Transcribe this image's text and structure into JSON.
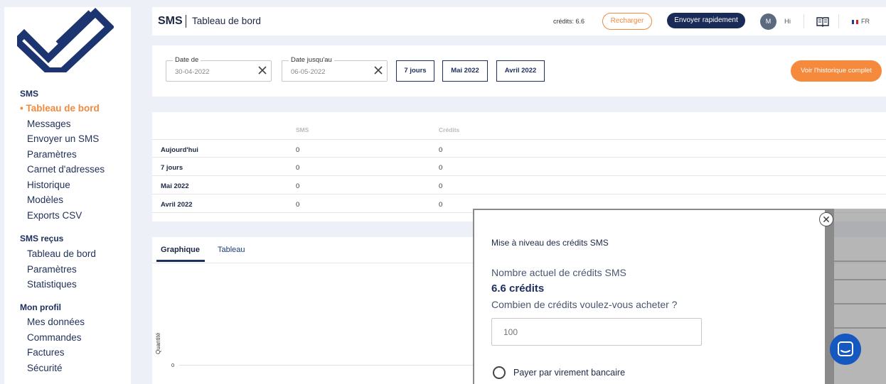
{
  "sidebar": {
    "sections": [
      {
        "title": "SMS",
        "items": [
          "• Tableau de bord",
          "Messages",
          "Envoyer un SMS",
          "Paramètres",
          "Carnet d'adresses",
          "Historique",
          "Modèles",
          "Exports CSV"
        ]
      },
      {
        "title": "SMS reçus",
        "items": [
          "Tableau de bord",
          "Paramètres",
          "Statistiques"
        ]
      },
      {
        "title": "Mon profil",
        "items": [
          "Mes données",
          "Commandes",
          "Factures",
          "Sécurité"
        ]
      }
    ]
  },
  "header": {
    "brand": "SMS",
    "subtitle": "Tableau de bord",
    "credits": "crédits: 6.6",
    "recharge_label": "Recharger",
    "send_quick_label": "Envoyer rapidement",
    "avatar_initial": "M",
    "greeting": "Hi",
    "language": "FR"
  },
  "filters": {
    "date_from_label": "Date de",
    "date_from_value": "30-04-2022",
    "date_to_label": "Date jusqu'au",
    "date_to_value": "06-05-2022",
    "ranges": [
      "7 jours",
      "Mai 2022",
      "Avril 2022"
    ],
    "history_label": "Voir l'historique complet"
  },
  "summary_table": {
    "columns": [
      "SMS",
      "Crédits"
    ],
    "rows": [
      {
        "label": "Aujourd'hui",
        "sms": "0",
        "credits": "0"
      },
      {
        "label": "7 jours",
        "sms": "0",
        "credits": "0"
      },
      {
        "label": "Mai 2022",
        "sms": "0",
        "credits": "0"
      },
      {
        "label": "Avril 2022",
        "sms": "0",
        "credits": "0"
      }
    ]
  },
  "chart": {
    "tabs": [
      "Graphique",
      "Tableau"
    ],
    "y_label": "Quantité",
    "y_tick": "0"
  },
  "modal": {
    "title": "Mise à niveau des crédits SMS",
    "current_label": "Nombre actuel de crédits SMS",
    "current_value": "6.6 crédits",
    "question": "Combien de crédits voulez-vous acheter ?",
    "input_placeholder": "100",
    "payment_option": "Payer par virement bancaire"
  },
  "colors": {
    "accent": "#f08a3e",
    "navy": "#1c2e5c",
    "chat": "#1558c0"
  }
}
